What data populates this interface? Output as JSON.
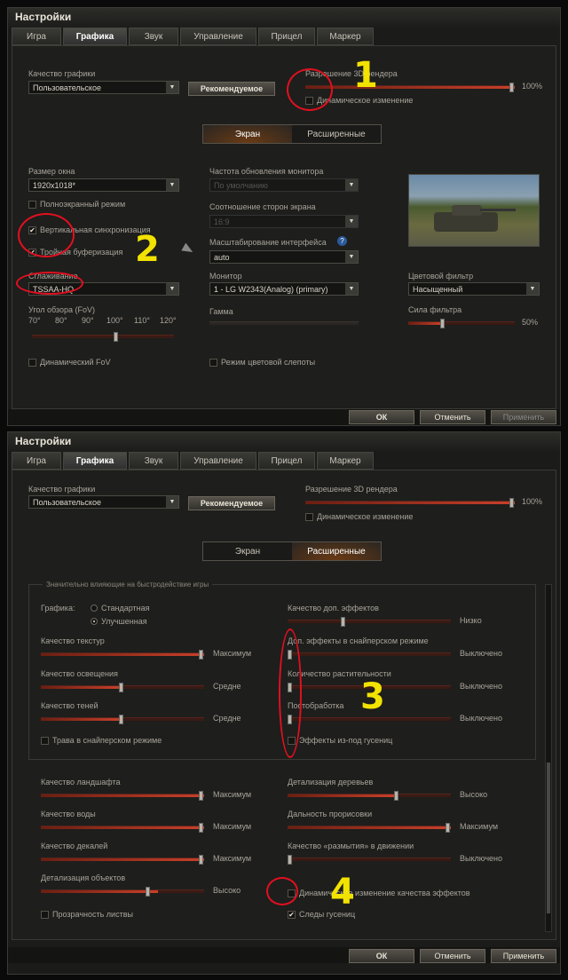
{
  "p1": {
    "title": "Настройки",
    "tabs": [
      "Игра",
      "Графика",
      "Звук",
      "Управление",
      "Прицел",
      "Маркер"
    ],
    "quality_label": "Качество графики",
    "quality_value": "Пользовательское",
    "recommended": "Рекомендуемое",
    "res3d_label": "Разрешение 3D рендера",
    "res3d_value": "100%",
    "dynamic_change": "Динамическое изменение",
    "subtab_screen": "Экран",
    "subtab_ext": "Расширенные",
    "window_size_label": "Размер окна",
    "window_size_value": "1920x1018*",
    "fullscreen": "Полноэкранный режим",
    "vsync": "Вертикальная синхронизация",
    "triple": "Тройная буферизация",
    "aa_label": "Сглаживание",
    "aa_value": "TSSAA-HQ",
    "fov_label": "Угол обзора (FoV)",
    "fov_ticks": [
      "70°",
      "80°",
      "90°",
      "100°",
      "110°",
      "120°"
    ],
    "dyn_fov": "Динамический FoV",
    "refresh_label": "Частота обновления монитора",
    "refresh_value": "По умолчанию",
    "aspect_label": "Соотношение сторон экрана",
    "aspect_value": "16:9",
    "scale_label": "Масштабирование интерфейса",
    "scale_value": "auto",
    "monitor_label": "Монитор",
    "monitor_value": "1 - LG W2343(Analog) (primary)",
    "gamma_label": "Гамма",
    "colorblind": "Режим цветовой слепоты",
    "filter_label": "Цветовой фильтр",
    "filter_value": "Насыщенный",
    "filter_strength_label": "Сила фильтра",
    "filter_strength_value": "50%",
    "ok": "ОК",
    "cancel": "Отменить",
    "apply": "Применить",
    "num1": "1",
    "num2": "2"
  },
  "p2": {
    "title": "Настройки",
    "tabs": [
      "Игра",
      "Графика",
      "Звук",
      "Управление",
      "Прицел",
      "Маркер"
    ],
    "quality_label": "Качество графики",
    "quality_value": "Пользовательское",
    "recommended": "Рекомендуемое",
    "res3d_label": "Разрешение 3D рендера",
    "res3d_value": "100%",
    "dynamic_change": "Динамическое изменение",
    "subtab_screen": "Экран",
    "subtab_ext": "Расширенные",
    "group_title": "Значительно влияющие на быстродействие игры",
    "graphics_label": "Графика:",
    "standard": "Стандартная",
    "improved": "Улучшенная",
    "textures": "Качество текстур",
    "textures_v": "Максимум",
    "lighting": "Качество освещения",
    "lighting_v": "Средне",
    "shadows": "Качество теней",
    "shadows_v": "Средне",
    "grass_sniper": "Трава в снайперском режиме",
    "extra_fx": "Качество доп. эффектов",
    "extra_fx_v": "Низко",
    "sniper_fx": "Доп. эффекты в снайперском режиме",
    "sniper_fx_v": "Выключено",
    "vegetation": "Количество растительности",
    "vegetation_v": "Выключено",
    "postfx": "Постобработка",
    "postfx_v": "Выключено",
    "track_fx": "Эффекты из-под гусениц",
    "landscape": "Качество ландшафта",
    "landscape_v": "Максимум",
    "water": "Качество воды",
    "water_v": "Максимум",
    "decals": "Качество декалей",
    "decals_v": "Максимум",
    "objects": "Детализация объектов",
    "objects_v": "Высоко",
    "foliage_transp": "Прозрачность листвы",
    "trees": "Детализация деревьев",
    "trees_v": "Высоко",
    "draw_distance": "Дальность прорисовки",
    "draw_distance_v": "Максимум",
    "motion_blur": "Качество «размытия» в движении",
    "motion_blur_v": "Выключено",
    "dyn_fx": "Динамическое изменение качества эффектов",
    "track_marks": "Следы гусениц",
    "ok": "ОК",
    "cancel": "Отменить",
    "apply": "Применить",
    "num3": "3",
    "num4": "4"
  },
  "colors": {
    "accent": "#c8402a",
    "annot_red": "#e01020",
    "annot_yellow": "#f2e200"
  }
}
